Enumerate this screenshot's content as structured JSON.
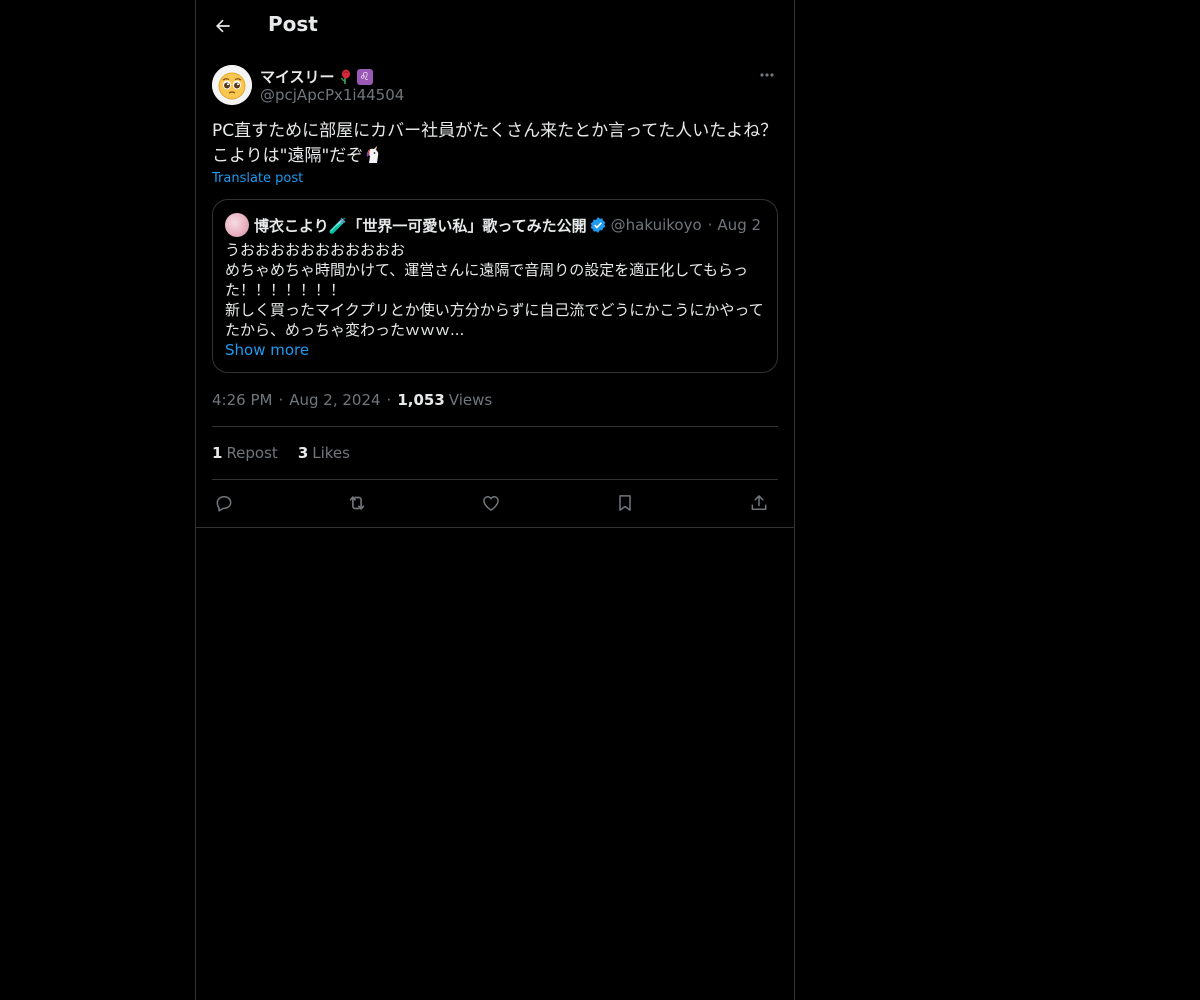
{
  "header": {
    "title": "Post",
    "back_icon": "arrow-left-icon"
  },
  "author": {
    "display_name": "マイスリー",
    "name_emojis": [
      "rose-icon",
      "leo-sign-icon"
    ],
    "leo_symbol": "♌",
    "handle": "@pcjApcPx1i44504",
    "avatar_icon": "pleading-face-icon",
    "more_icon": "more-dots-icon"
  },
  "post": {
    "lines": [
      "PC直すために部屋にカバー社員がたくさん来たとか言ってた人いたよね？",
      "こよりは\"遠隔\"だぞ"
    ],
    "trailing_emoji": "unicorn-icon",
    "translate_label": "Translate post"
  },
  "quote": {
    "name": "博衣こより🧪「世界一可愛い私」歌ってみた公開",
    "handle": "@hakuikoyori",
    "separator": "·",
    "date": "Aug 2",
    "lines": [
      "うおおおおおおおおおおお",
      "めちゃめちゃ時間かけて、運営さんに遠隔で音周りの設定を適正化してもらっ",
      "た！！！！！！！",
      "新しく買ったマイクプリとか使い方分からずに自己流でどうにかこうにかやって",
      "たから、めっちゃ変わったｗｗｗ..."
    ],
    "show_more_label": "Show more"
  },
  "meta": {
    "time": "4:26 PM",
    "separator": "·",
    "date": "Aug 2, 2024",
    "views_count": "1,053",
    "views_label": "Views"
  },
  "stats": {
    "reposts_count": "1",
    "reposts_label": "Repost",
    "likes_count": "3",
    "likes_label": "Likes"
  },
  "actions": [
    {
      "name": "reply",
      "icon": "reply-icon"
    },
    {
      "name": "repost",
      "icon": "repost-icon"
    },
    {
      "name": "like",
      "icon": "heart-icon"
    },
    {
      "name": "bookmark",
      "icon": "bookmark-icon"
    },
    {
      "name": "share",
      "icon": "share-icon"
    }
  ],
  "colors": {
    "background": "#000000",
    "text_primary": "#e7e9ea",
    "text_secondary": "#71767b",
    "accent": "#1d9bf0",
    "border": "#2f3336"
  }
}
